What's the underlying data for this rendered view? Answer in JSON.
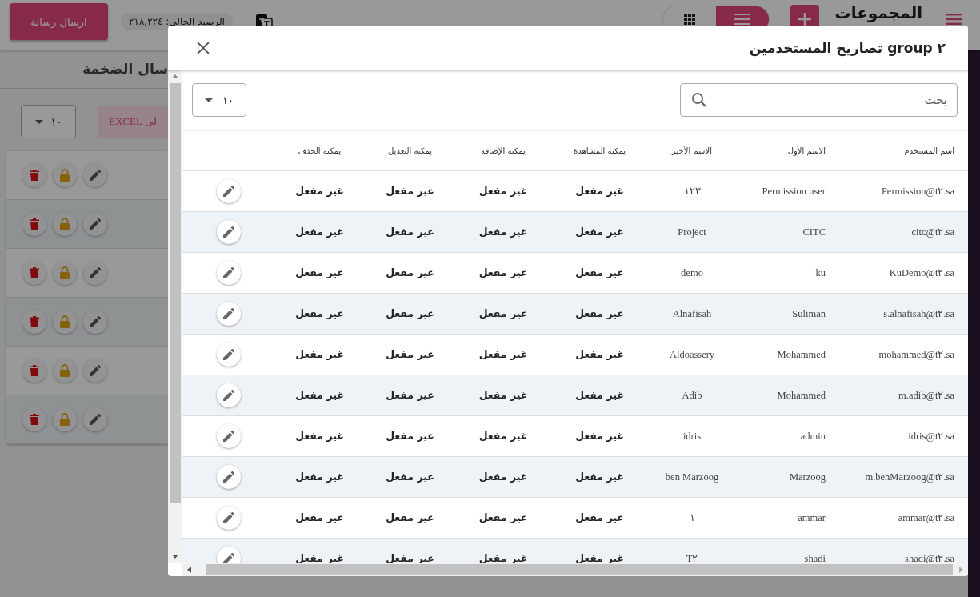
{
  "background": {
    "title": "المجموعات",
    "view_toggle": [
      {
        "kind": "grid",
        "selected": false
      },
      {
        "kind": "list",
        "selected": true
      }
    ],
    "balance": "الرصيد الحالي: ٢١٨,٢٢٤",
    "send_button": "ارسال رسالة",
    "section_title": "سال الضخمة",
    "page_size": "١٠",
    "export_button": "لى EXCEL",
    "group_rows": [
      {
        "kind": "actions"
      },
      {
        "kind": "actions"
      },
      {
        "kind": "actions"
      },
      {
        "kind": "actions"
      },
      {
        "kind": "actions"
      },
      {
        "kind": "actions"
      }
    ]
  },
  "modal": {
    "title": "٢ group تصاريح المستخدمين",
    "search": {
      "placeholder": "بحث"
    },
    "page_size": "١٠",
    "table": {
      "columns": [
        "اسم المستخدم",
        "الاسم الأول",
        "الاسم الأخير",
        "يمكنه المشاهدة",
        "يمكنه الإضافة",
        "يمكنه التعديل",
        "يمكنه الحذف"
      ],
      "rows": [
        {
          "username": "Permission@t٢.sa",
          "first_name": "Permission user",
          "last_name": "١٢٣",
          "can_view": "غير مفعل",
          "can_add": "غير مفعل",
          "can_edit": "غير مفعل",
          "can_delete": "غير مفعل"
        },
        {
          "username": "citc@t٢.sa",
          "first_name": "CITC",
          "last_name": "Project",
          "can_view": "غير مفعل",
          "can_add": "غير مفعل",
          "can_edit": "غير مفعل",
          "can_delete": "غير مفعل"
        },
        {
          "username": "KuDemo@t٢.sa",
          "first_name": "ku",
          "last_name": "demo",
          "can_view": "غير مفعل",
          "can_add": "غير مفعل",
          "can_edit": "غير مفعل",
          "can_delete": "غير مفعل"
        },
        {
          "username": "s.alnafisah@t٢.sa",
          "first_name": "Suliman",
          "last_name": "Alnafisah",
          "can_view": "غير مفعل",
          "can_add": "غير مفعل",
          "can_edit": "غير مفعل",
          "can_delete": "غير مفعل"
        },
        {
          "username": "mohammed@t٢.sa",
          "first_name": "Mohammed",
          "last_name": "Aldoassery",
          "can_view": "غير مفعل",
          "can_add": "غير مفعل",
          "can_edit": "غير مفعل",
          "can_delete": "غير مفعل"
        },
        {
          "username": "m.adib@t٢.sa",
          "first_name": "Mohammed",
          "last_name": "Adib",
          "can_view": "غير مفعل",
          "can_add": "غير مفعل",
          "can_edit": "غير مفعل",
          "can_delete": "غير مفعل"
        },
        {
          "username": "idris@t٢.sa",
          "first_name": "admin",
          "last_name": "idris",
          "can_view": "غير مفعل",
          "can_add": "غير مفعل",
          "can_edit": "غير مفعل",
          "can_delete": "غير مفعل"
        },
        {
          "username": "m.benMarzoog@t٢.sa",
          "first_name": "Marzoog",
          "last_name": "ben Marzoog",
          "can_view": "غير مفعل",
          "can_add": "غير مفعل",
          "can_edit": "غير مفعل",
          "can_delete": "غير مفعل"
        },
        {
          "username": "ammar@t٢.sa",
          "first_name": "ammar",
          "last_name": "١",
          "can_view": "غير مفعل",
          "can_add": "غير مفعل",
          "can_edit": "غير مفعل",
          "can_delete": "غير مفعل"
        },
        {
          "username": "shadi@t٢.sa",
          "first_name": "shadi",
          "last_name": "T٢",
          "can_view": "غير مفعل",
          "can_add": "غير مفعل",
          "can_edit": "غير مفعل",
          "can_delete": "غير مفعل"
        }
      ]
    }
  }
}
